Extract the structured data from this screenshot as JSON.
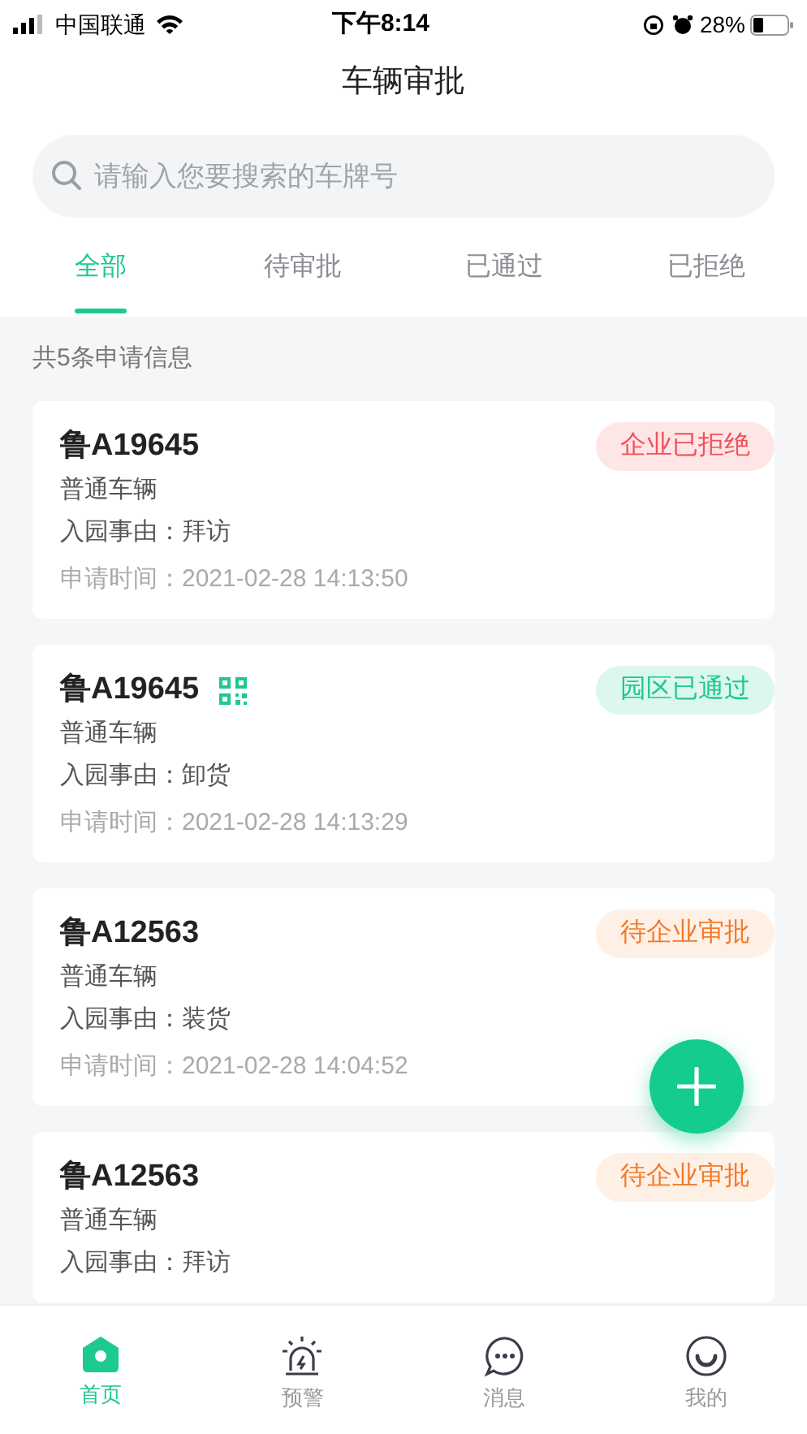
{
  "status_bar": {
    "carrier": "中国联通",
    "time": "下午8:14",
    "battery": "28%"
  },
  "title": "车辆审批",
  "search": {
    "placeholder": "请输入您要搜索的车牌号"
  },
  "tabs": [
    {
      "label": "全部",
      "selected": true
    },
    {
      "label": "待审批",
      "selected": false
    },
    {
      "label": "已通过",
      "selected": false
    },
    {
      "label": "已拒绝",
      "selected": false
    }
  ],
  "summary": "共5条申请信息",
  "records": [
    {
      "plate": "鲁A19645",
      "qr_code": false,
      "status": "企业已拒绝",
      "kind": "rejected",
      "vehicle_type": "普通车辆",
      "reason": "入园事由：拜访",
      "time": "申请时间：2021-02-28 14:13:50"
    },
    {
      "plate": "鲁A19645",
      "qr_code": true,
      "status": "园区已通过",
      "kind": "approved",
      "vehicle_type": "普通车辆",
      "reason": "入园事由：卸货",
      "time": "申请时间：2021-02-28 14:13:29"
    },
    {
      "plate": "鲁A12563",
      "qr_code": false,
      "status": "待企业审批",
      "kind": "pending",
      "vehicle_type": "普通车辆",
      "reason": "入园事由：装货",
      "time": "申请时间：2021-02-28 14:04:52"
    },
    {
      "plate": "鲁A12563",
      "qr_code": false,
      "status": "待企业审批",
      "kind": "pending",
      "vehicle_type": "普通车辆",
      "reason": "入园事由：拜访"
    }
  ],
  "bottom_nav": [
    {
      "label": "首页",
      "kind": "home",
      "selected": true
    },
    {
      "label": "预警",
      "kind": "alarm",
      "selected": false
    },
    {
      "label": "消息",
      "kind": "message",
      "selected": false
    },
    {
      "label": "我的",
      "kind": "profile",
      "selected": false
    }
  ]
}
